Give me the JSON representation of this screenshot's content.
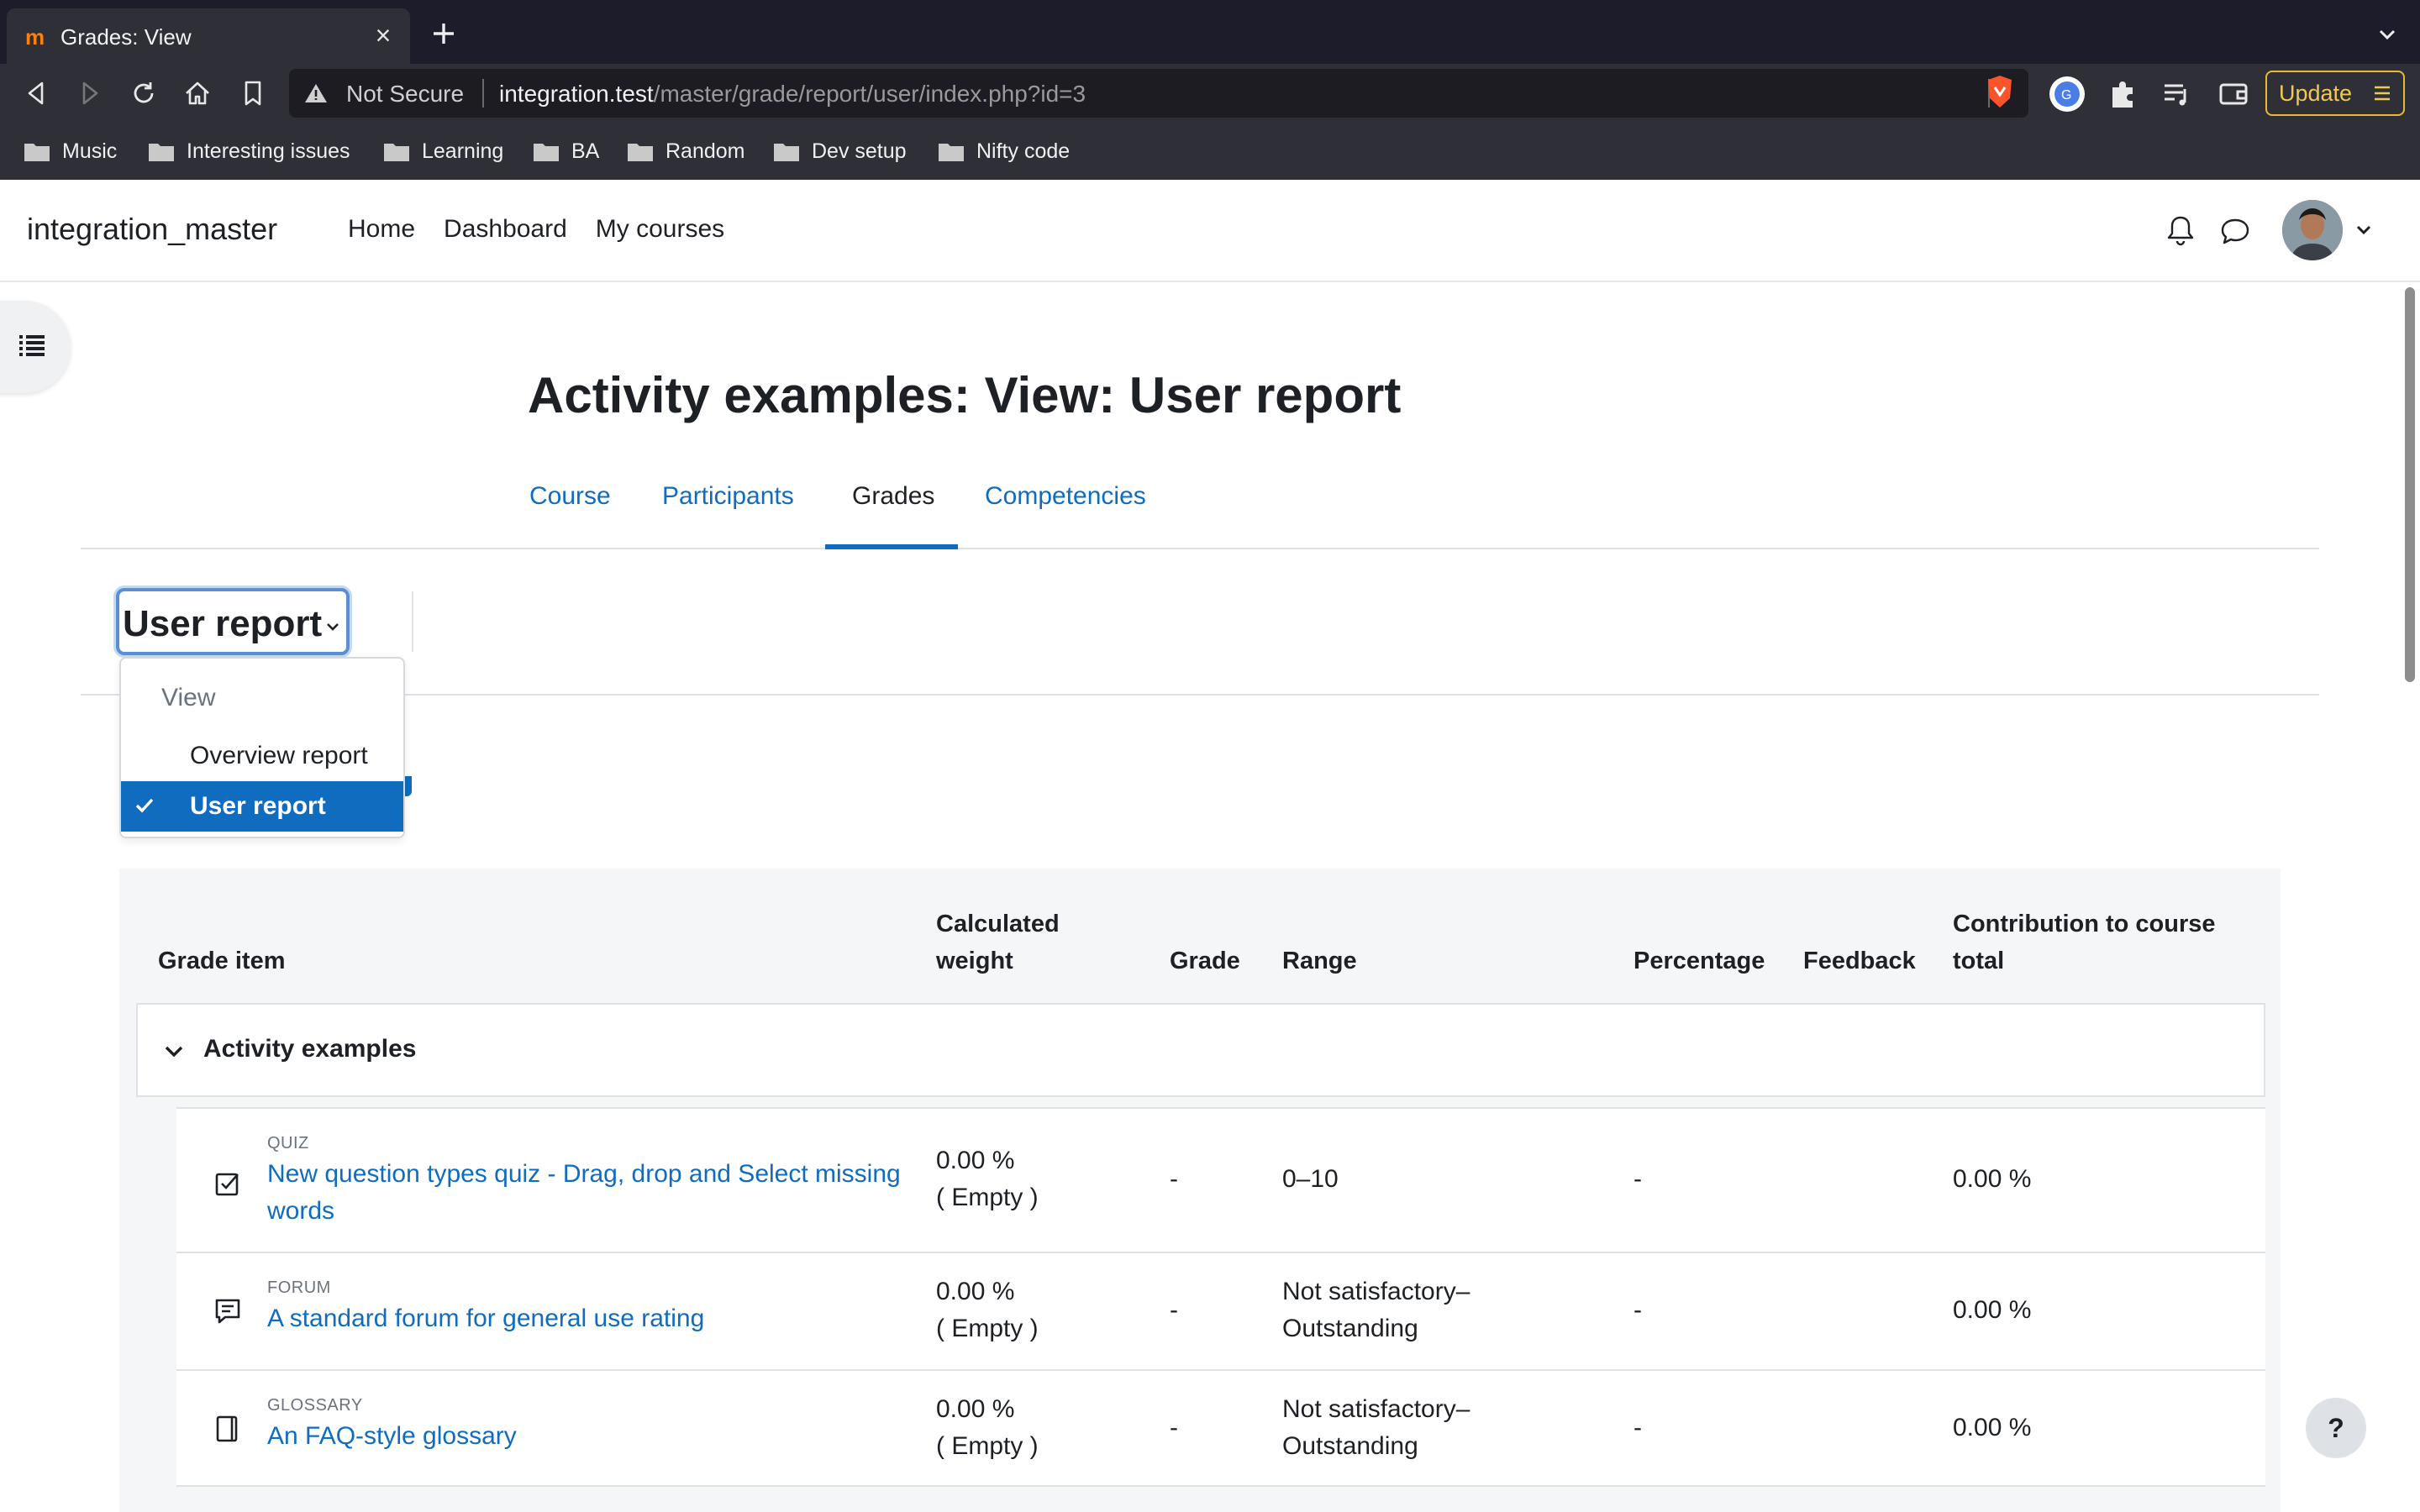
{
  "browser": {
    "tab_title": "Grades: View",
    "url_warning": "Not Secure",
    "url_host": "integration.test",
    "url_path": "/master/grade/report/user/index.php?id=3",
    "update_label": "Update",
    "bookmarks": [
      "Music",
      "Interesting issues",
      "Learning",
      "BA",
      "Random",
      "Dev setup",
      "Nifty code"
    ]
  },
  "navbar": {
    "site_name": "integration_master",
    "links": [
      "Home",
      "Dashboard",
      "My courses"
    ]
  },
  "page": {
    "title": "Activity examples: View: User report",
    "tabs": [
      "Course",
      "Participants",
      "Grades",
      "Competencies"
    ],
    "active_tab": "Grades"
  },
  "report_selector": {
    "current": "User report",
    "menu_header": "View",
    "options": [
      "Overview report",
      "User report"
    ],
    "selected": "User report"
  },
  "table": {
    "headers": {
      "item": "Grade item",
      "weight_line1": "Calculated",
      "weight_line2": "weight",
      "grade": "Grade",
      "range": "Range",
      "percentage": "Percentage",
      "feedback": "Feedback",
      "contribution_line1": "Contribution to course",
      "contribution_line2": "total"
    },
    "category": "Activity examples",
    "rows": [
      {
        "type": "QUIZ",
        "name_line1": "New question types quiz - Drag, drop and Select missing",
        "name_line2": "words",
        "weight": "0.00 %",
        "weight_note": "( Empty )",
        "grade": "-",
        "range_line1": "0–10",
        "range_line2": "",
        "percentage": "-",
        "contribution": "0.00 %"
      },
      {
        "type": "FORUM",
        "name_line1": "A standard forum for general use rating",
        "name_line2": "",
        "weight": "0.00 %",
        "weight_note": "( Empty )",
        "grade": "-",
        "range_line1": "Not satisfactory–",
        "range_line2": "Outstanding",
        "percentage": "-",
        "contribution": "0.00 %"
      },
      {
        "type": "GLOSSARY",
        "name_line1": "An FAQ-style glossary",
        "name_line2": "",
        "weight": "0.00 %",
        "weight_note": "( Empty )",
        "grade": "-",
        "range_line1": "Not satisfactory–",
        "range_line2": "Outstanding",
        "percentage": "-",
        "contribution": "0.00 %"
      }
    ]
  },
  "help_label": "?"
}
